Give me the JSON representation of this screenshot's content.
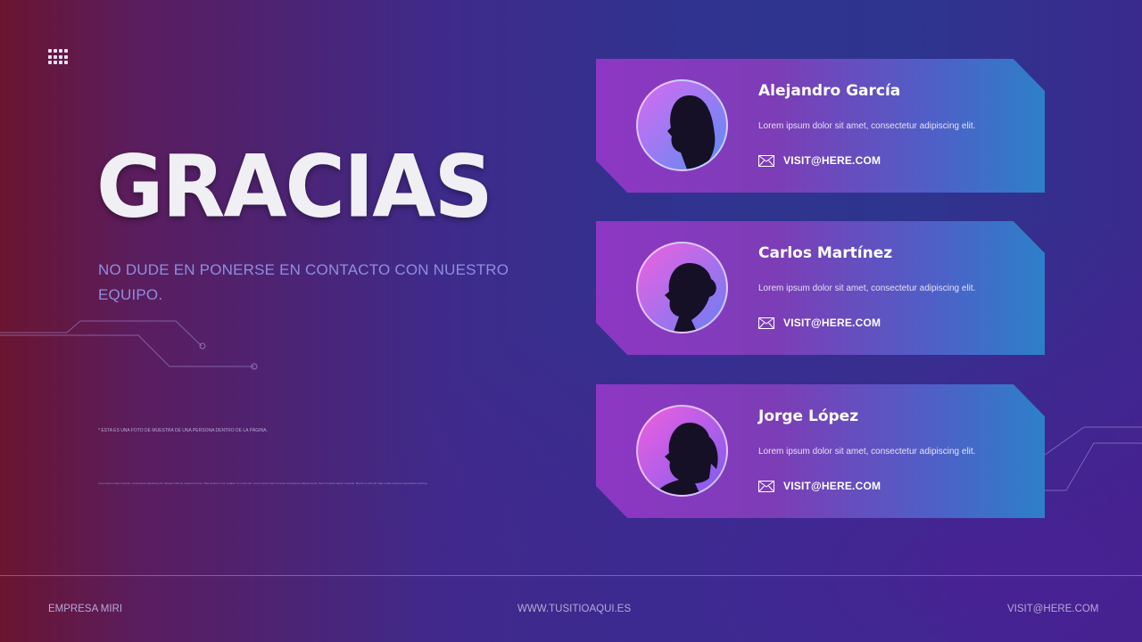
{
  "title": "GRACIAS",
  "subtitle": "NO DUDE EN PONERSE EN CONTACTO CON NUESTRO EQUIPO.",
  "note": "* ESTA ES UNA FOTO DE MUESTRA DE UNA PERSONA DENTRO DE LA PÁGINA.",
  "body_text": "Lorem ipsum dolor sit amet, consectetur adipiscing elit. Aliquam nibh ac massa rhoncus. Vitae aenean nunc sodales ut in id id nisl. Lorem ipsum dolor sit amet consectetur adipiscing elit. Sed ut mauris sapien molestie. Mauris ut velit elit. Nam mollis pulvinar suspendisse pulvinar.",
  "cards": [
    {
      "name": "Alejandro García",
      "desc": "Lorem ipsum dolor sit amet, consectetur adipiscing elit.",
      "email": "VISIT@HERE.COM"
    },
    {
      "name": "Carlos Martínez",
      "desc": "Lorem ipsum dolor sit amet, consectetur adipiscing elit.",
      "email": "VISIT@HERE.COM"
    },
    {
      "name": "Jorge López",
      "desc": "Lorem ipsum dolor sit amet, consectetur adipiscing elit.",
      "email": "VISIT@HERE.COM"
    }
  ],
  "footer": {
    "company": "EMPRESA MIRI",
    "website": "WWW.TUSITIOAQUI.ES",
    "email": "VISIT@HERE.COM"
  },
  "colors": {
    "accent_text": "#8f8ee0",
    "card_left": "#8d37c4",
    "card_right": "#2d80c9"
  }
}
